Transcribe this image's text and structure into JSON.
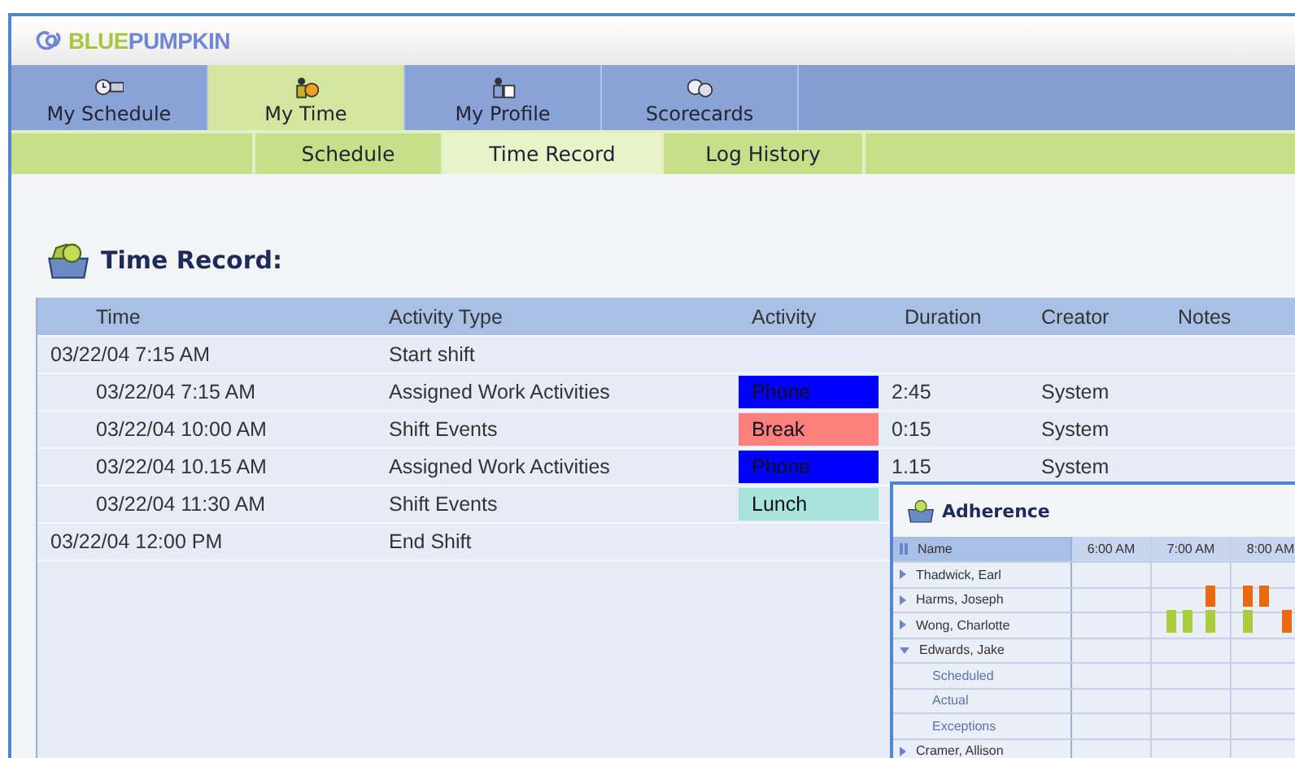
{
  "logo": {
    "first": "BLUE",
    "second": "PUMPKIN"
  },
  "tabs": [
    {
      "label": "My Schedule",
      "kind": "clock",
      "selected": false
    },
    {
      "label": "My Time",
      "kind": "person",
      "selected": true
    },
    {
      "label": "My Profile",
      "kind": "profile",
      "selected": false
    },
    {
      "label": "Scorecards",
      "kind": "faces",
      "selected": false
    }
  ],
  "subtabs": [
    {
      "label": "Schedule",
      "selected": false
    },
    {
      "label": "Time Record",
      "selected": true
    },
    {
      "label": "Log History",
      "selected": false
    }
  ],
  "section_title": "Time Record:",
  "table": {
    "columns": [
      "Time",
      "Activity Type",
      "Activity",
      "Duration",
      "Creator",
      "Notes"
    ],
    "rows": [
      {
        "time": "03/22/04 7:15 AM",
        "activity_type": "Start shift",
        "children": [
          {
            "time": "03/22/04 7:15 AM",
            "activity_type": "Assigned Work Activities",
            "activity": "Phone",
            "color": "#0000ff",
            "duration": "2:45",
            "creator": "System"
          },
          {
            "time": "03/22/04 10:00 AM",
            "activity_type": "Shift Events",
            "activity": "Break",
            "color": "#ff7f7f",
            "duration": "0:15",
            "creator": "System"
          },
          {
            "time": "03/22/04 10.15 AM",
            "activity_type": "Assigned Work Activities",
            "activity": "Phone",
            "color": "#0000ff",
            "duration": "1.15",
            "creator": "System"
          },
          {
            "time": "03/22/04 11:30 AM",
            "activity_type": "Shift Events",
            "activity": "Lunch",
            "color": "#a8e4dc"
          }
        ]
      },
      {
        "time": "03/22/04 12:00 PM",
        "activity_type": "End Shift"
      }
    ]
  },
  "adherence": {
    "title": "Adherence",
    "columns": [
      "Name",
      "6:00 AM",
      "7:00 AM",
      "8:00 AM"
    ],
    "rows": [
      {
        "name": "Thadwick, Earl",
        "expanded": false
      },
      {
        "name": "Harms, Joseph",
        "expanded": false
      },
      {
        "name": "Wong, Charlotte",
        "expanded": false
      },
      {
        "name": "Edwards, Jake",
        "expanded": true,
        "children": [
          {
            "name": "Scheduled"
          },
          {
            "name": "Actual"
          },
          {
            "name": "Exceptions"
          }
        ]
      },
      {
        "name": "Cramer, Allison",
        "expanded": false
      }
    ]
  }
}
